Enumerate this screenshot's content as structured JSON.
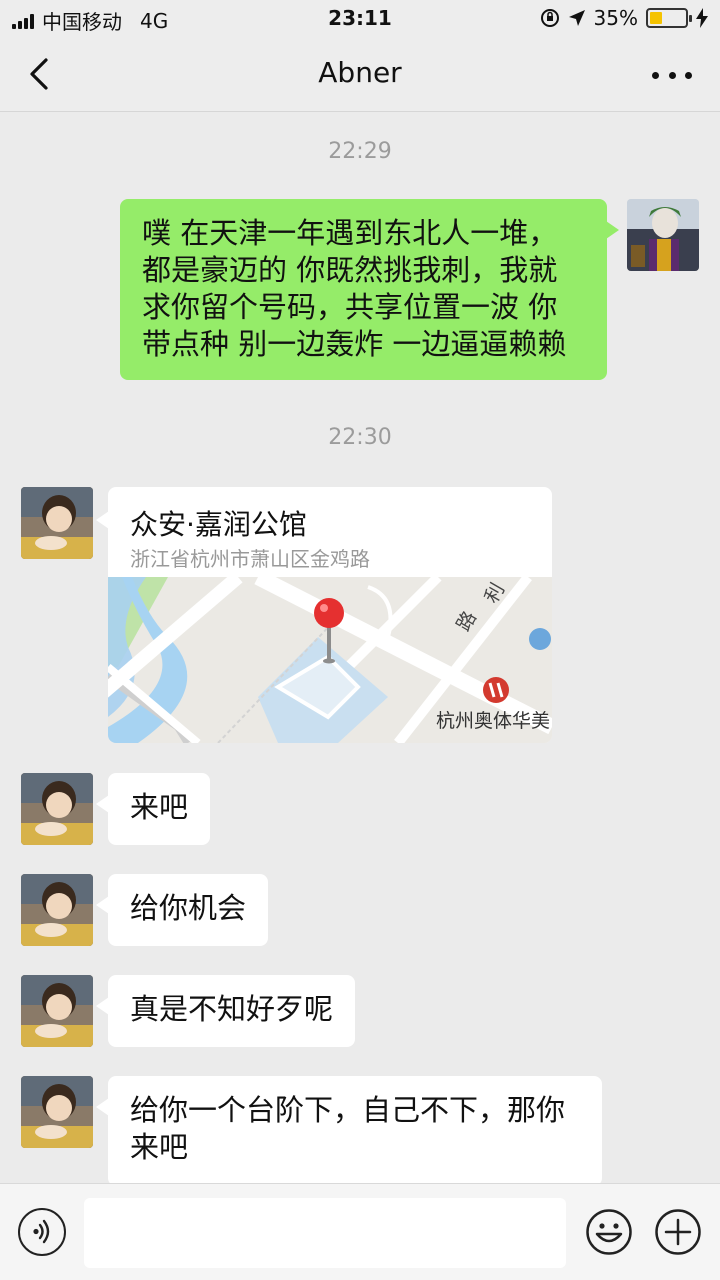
{
  "status_bar": {
    "carrier": "中国移动",
    "network": "4G",
    "time": "23:11",
    "battery": "35%",
    "battery_level": 0.35
  },
  "nav": {
    "title": "Abner",
    "back_icon": "chevron-left-icon",
    "more_icon": "more-dots-icon"
  },
  "messages": {
    "time_1": "22:29",
    "me_1": "噗  在天津一年遇到东北人一堆，都是豪迈的 你既然挑我刺，我就求你留个号码，共享位置一波  你带点种  别一边轰炸 一边逼逼赖赖",
    "time_2": "22:30",
    "location": {
      "name": "众安·嘉润公馆",
      "address": "浙江省杭州市萧山区金鸡路",
      "map_poi": "杭州奥体华美",
      "map_road": "利"
    },
    "other_1": "来吧",
    "other_2": "给你机会",
    "other_3": "真是不知好歹呢",
    "other_4": "给你一个台阶下，自己不下，那你来吧"
  },
  "input_bar": {
    "voice_icon": "voice-icon",
    "emoji_icon": "emoji-icon",
    "plus_icon": "plus-icon",
    "placeholder": ""
  },
  "colors": {
    "my_bubble": "#95ec69",
    "other_bubble": "#ffffff",
    "background": "#ebebeb"
  }
}
